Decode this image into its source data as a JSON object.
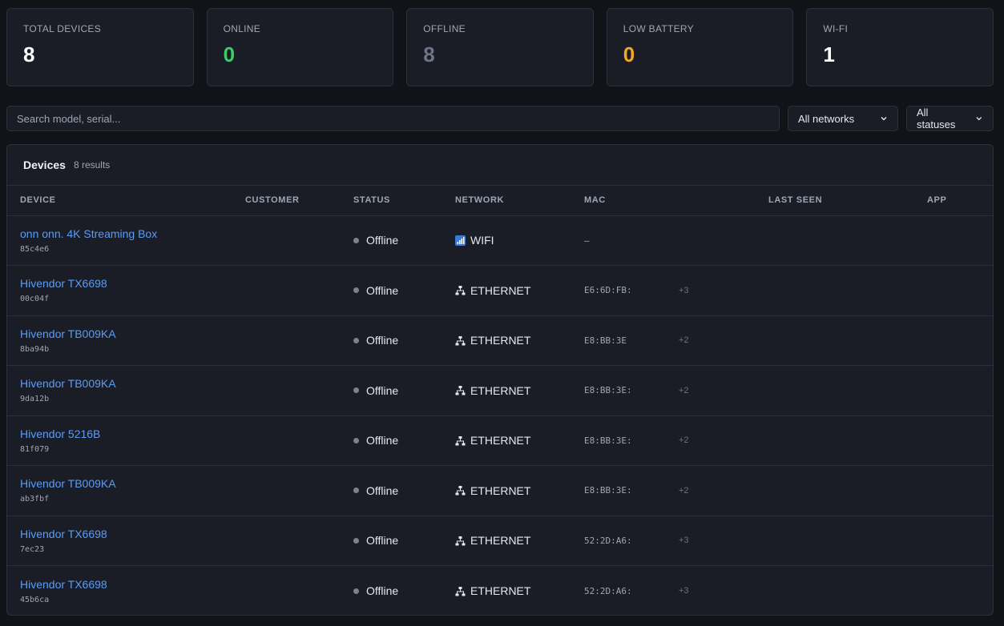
{
  "stats": [
    {
      "label": "TOTAL DEVICES",
      "value": "8",
      "color": "#ffffff"
    },
    {
      "label": "ONLINE",
      "value": "0",
      "color": "#3fca6b"
    },
    {
      "label": "OFFLINE",
      "value": "8",
      "color": "#6f7587"
    },
    {
      "label": "LOW BATTERY",
      "value": "0",
      "color": "#f5a524"
    },
    {
      "label": "WI-FI",
      "value": "1",
      "color": "#ffffff"
    }
  ],
  "filters": {
    "search_placeholder": "Search model, serial...",
    "network_selected": "All networks",
    "status_selected": "All statuses"
  },
  "panel": {
    "title": "Devices",
    "count": "8 results"
  },
  "columns": [
    "DEVICE",
    "CUSTOMER",
    "STATUS",
    "NETWORK",
    "MAC",
    "LAST SEEN",
    "APP"
  ],
  "devices": [
    {
      "name": "onn onn. 4K Streaming Box",
      "serial": "85c4e6",
      "customer": "",
      "status": "Offline",
      "network": "WIFI",
      "network_icon": "wifi-icon",
      "mac": "–",
      "mac_more": "",
      "last_seen": "",
      "app": ""
    },
    {
      "name": "Hivendor TX6698",
      "serial": "00c04f",
      "customer": "",
      "status": "Offline",
      "network": "ETHERNET",
      "network_icon": "ethernet-icon",
      "mac": "E6:6D:FB:",
      "mac_more": "+3",
      "last_seen": "",
      "app": ""
    },
    {
      "name": "Hivendor TB009KA",
      "serial": "8ba94b",
      "customer": "",
      "status": "Offline",
      "network": "ETHERNET",
      "network_icon": "ethernet-icon",
      "mac": "E8:BB:3E",
      "mac_more": "+2",
      "last_seen": "",
      "app": ""
    },
    {
      "name": "Hivendor TB009KA",
      "serial": "9da12b",
      "customer": "",
      "status": "Offline",
      "network": "ETHERNET",
      "network_icon": "ethernet-icon",
      "mac": "E8:BB:3E:",
      "mac_more": "+2",
      "last_seen": "",
      "app": ""
    },
    {
      "name": "Hivendor 5216B",
      "serial": "81f079",
      "customer": "",
      "status": "Offline",
      "network": "ETHERNET",
      "network_icon": "ethernet-icon",
      "mac": "E8:BB:3E:",
      "mac_more": "+2",
      "last_seen": "",
      "app": ""
    },
    {
      "name": "Hivendor TB009KA",
      "serial": "ab3fbf",
      "customer": "",
      "status": "Offline",
      "network": "ETHERNET",
      "network_icon": "ethernet-icon",
      "mac": "E8:BB:3E:",
      "mac_more": "+2",
      "last_seen": "",
      "app": ""
    },
    {
      "name": "Hivendor TX6698",
      "serial": "7ec23",
      "customer": "",
      "status": "Offline",
      "network": "ETHERNET",
      "network_icon": "ethernet-icon",
      "mac": "52:2D:A6:",
      "mac_more": "+3",
      "last_seen": "",
      "app": ""
    },
    {
      "name": "Hivendor TX6698",
      "serial": "45b6ca",
      "customer": "",
      "status": "Offline",
      "network": "ETHERNET",
      "network_icon": "ethernet-icon",
      "mac": "52:2D:A6:",
      "mac_more": "+3",
      "last_seen": "",
      "app": ""
    }
  ],
  "colors": {
    "link": "#5b9cf5",
    "offline_dot": "#7c8290",
    "background": "#111318",
    "card": "#1a1d26"
  }
}
